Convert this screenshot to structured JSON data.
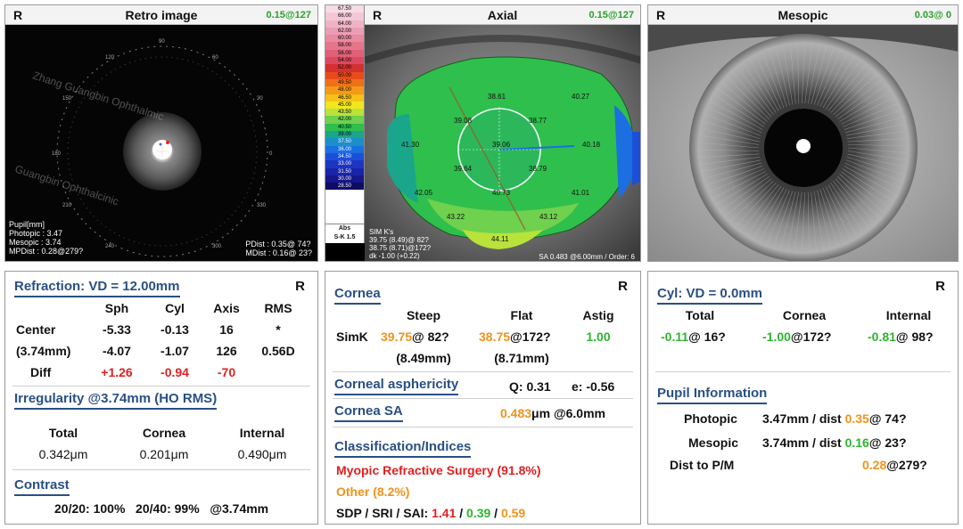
{
  "panels": {
    "retro": {
      "eye": "R",
      "title": "Retro image",
      "code": "0.15@127",
      "pupil_label": "Pupil[mm]",
      "photopic": "Photopic : 3.47",
      "mesopic": "Mesopic : 3.74",
      "mpdist": "MPDist : 0.28@279?",
      "pdist": "PDist : 0.35@ 74?",
      "mdist": "MDist : 0.16@ 23?",
      "watermark_1": "Zhang Guangbin Ophthalmic",
      "watermark_2": "Guangbin Ophthalcinic"
    },
    "axial": {
      "eye": "R",
      "title": "Axial",
      "code": "0.15@127",
      "scale_values": [
        "67.50",
        "66.00",
        "64.00",
        "62.00",
        "60.00",
        "58.00",
        "56.00",
        "54.00",
        "52.00",
        "50.00",
        "49.50",
        "48.00",
        "46.50",
        "45.00",
        "43.50",
        "42.00",
        "40.50",
        "39.00",
        "37.50",
        "36.00",
        "34.50",
        "33.00",
        "31.50",
        "30.00",
        "28.50"
      ],
      "scale_colors": [
        "#f7dbe6",
        "#f4c7d7",
        "#efb3c6",
        "#ea9eb3",
        "#e88aa0",
        "#e4768c",
        "#e06078",
        "#d94a60",
        "#d43030",
        "#e84a1a",
        "#f0701a",
        "#f59a18",
        "#f6c21a",
        "#f2e61e",
        "#b9e23a",
        "#6fd14e",
        "#2fbf4c",
        "#1aa68a",
        "#1b8fc7",
        "#1b6fe0",
        "#1b4fd9",
        "#1c36c2",
        "#1a24a6",
        "#15178a",
        "#0d0d66"
      ],
      "scale_label_1": "Abs",
      "scale_label_2": "S-K 1.5",
      "values": [
        {
          "label": "38.61"
        },
        {
          "label": "40.27"
        },
        {
          "label": "39.08"
        },
        {
          "label": "38.77"
        },
        {
          "label": "41.30"
        },
        {
          "label": "39.06"
        },
        {
          "label": "40.18"
        },
        {
          "label": "39.64"
        },
        {
          "label": "38.79"
        },
        {
          "label": "42.05"
        },
        {
          "label": "40.73"
        },
        {
          "label": "41.01"
        },
        {
          "label": "43.22"
        },
        {
          "label": "43.12"
        },
        {
          "label": "44.11"
        }
      ],
      "simk_title": "SIM K's",
      "simk_1": "39.75 (8.49)@ 82?",
      "simk_2": "38.75 (8.71)@172?",
      "dk": "dk -1.00 (+0.22)",
      "sa": "SA  0.483 @6.00mm / Order: 6"
    },
    "mesopic": {
      "eye": "R",
      "title": "Mesopic",
      "code": "0.03@  0"
    }
  },
  "refraction": {
    "corner": "R",
    "header": "Refraction: VD = 12.00mm",
    "col_sph": "Sph",
    "col_cyl": "Cyl",
    "col_axis": "Axis",
    "col_rms": "RMS",
    "rows": [
      {
        "label": "Center",
        "sph": "-5.33",
        "cyl": "-0.13",
        "axis": "16",
        "rms": "*"
      },
      {
        "label": "(3.74mm)",
        "sph": "-4.07",
        "cyl": "-1.07",
        "axis": "126",
        "rms": "0.56D"
      },
      {
        "label": "Diff",
        "sph": "+1.26",
        "cyl": "-0.94",
        "axis": "-70",
        "rms": ""
      }
    ],
    "irregularity_header": "Irregularity @3.74mm (HO RMS)",
    "irr_total_label": "Total",
    "irr_cornea_label": "Cornea",
    "irr_internal_label": "Internal",
    "irr_total": "0.342μm",
    "irr_cornea": "0.201μm",
    "irr_internal": "0.490μm",
    "contrast_header": "Contrast",
    "contrast_line": "20/20: 100%   20/40: 99%   @3.74mm"
  },
  "cornea": {
    "corner": "R",
    "header": "Cornea",
    "col_steep": "Steep",
    "col_flat": "Flat",
    "col_astig": "Astig",
    "simk_label": "SimK",
    "steep_k": "39.75",
    "steep_axis": "@ 82?",
    "flat_k": "38.75",
    "flat_axis": "@172?",
    "astig": "1.00",
    "steep_mm": "(8.49mm)",
    "flat_mm": "(8.71mm)",
    "asphericity_header": "Corneal asphericity",
    "q_value": "Q: 0.31",
    "e_value": "e: -0.56",
    "sa_header": "Cornea SA",
    "sa_value": "0.483",
    "sa_unit": "μm @6.0mm",
    "class_header": "Classification/Indices",
    "class_1": "Myopic Refractive Surgery (91.8%)",
    "class_2": "Other (8.2%)",
    "indices_label": "SDP / SRI / SAI: ",
    "sdp": "1.41",
    "sri": "0.39",
    "sai": "0.59",
    "slash": " / "
  },
  "cyl": {
    "corner": "R",
    "header": "Cyl: VD = 0.0mm",
    "col_total": "Total",
    "col_cornea": "Cornea",
    "col_internal": "Internal",
    "total_val": "-0.11",
    "total_axis": "@ 16?",
    "cornea_val": "-1.00",
    "cornea_axis": "@172?",
    "internal_val": "-0.81",
    "internal_axis": "@ 98?",
    "pupil_header": "Pupil Information",
    "photopic_label": "Photopic",
    "photopic_size": "3.47mm / dist ",
    "photopic_dist": "0.35",
    "photopic_axis": "@ 74?",
    "mesopic_label": "Mesopic",
    "mesopic_size": "3.74mm / dist ",
    "mesopic_dist": "0.16",
    "mesopic_axis": "@ 23?",
    "distpm_label": "Dist to P/M",
    "distpm_dist": "0.28",
    "distpm_axis": "@279?"
  }
}
